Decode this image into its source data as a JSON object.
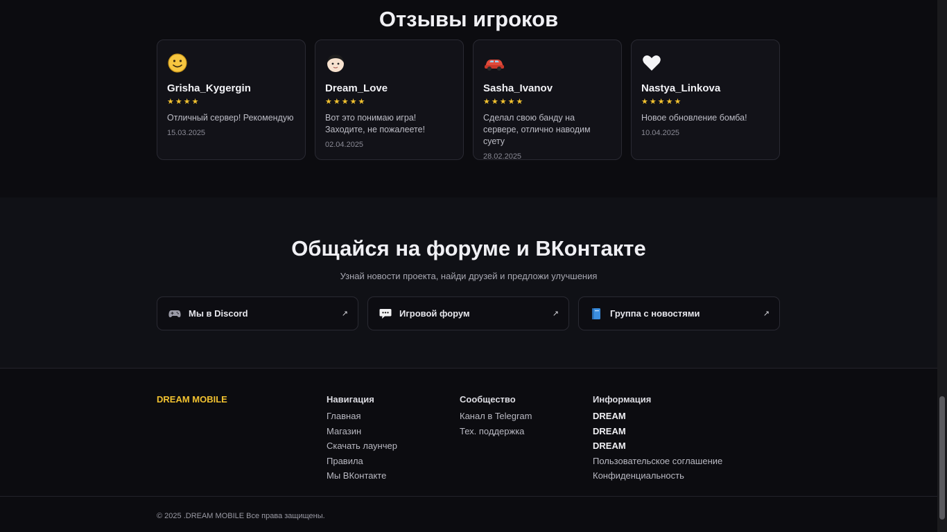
{
  "reviews": {
    "title": "Отзывы игроков",
    "items": [
      {
        "icon": "smiley-face-icon",
        "name": "Grisha_Kygergin",
        "stars": "★★★★",
        "text": "Отличный сервер! Рекомендую",
        "date": "15.03.2025"
      },
      {
        "icon": "person-face-icon",
        "name": "Dream_Love",
        "stars": "★★★★★",
        "text": "Вот это понимаю игра! Заходите, не пожалеете!",
        "date": "02.04.2025"
      },
      {
        "icon": "car-icon",
        "name": "Sasha_Ivanov",
        "stars": "★★★★★",
        "text": "Сделал свою банду на сервере, отлично наводим суету",
        "date": "28.02.2025"
      },
      {
        "icon": "white-heart-icon",
        "name": "Nastya_Linkova",
        "stars": "★★★★★",
        "text": "Новое обновление бомба!",
        "date": "10.04.2025"
      }
    ]
  },
  "community": {
    "title": "Общайся на форуме и ВКонтакте",
    "subtitle": "Узнай новости проекта, найди друзей и предложи улучшения",
    "links": [
      {
        "icon": "gamepad-icon",
        "label": "Мы в Discord",
        "arrow": "↗"
      },
      {
        "icon": "speech-bubble-icon",
        "label": "Игровой форум",
        "arrow": "↗"
      },
      {
        "icon": "book-icon",
        "label": "Группа с новостями",
        "arrow": "↗"
      }
    ]
  },
  "footer": {
    "brand": "DREAM MOBILE",
    "nav": {
      "title": "Навигация",
      "items": [
        "Главная",
        "Магазин",
        "Скачать лаунчер",
        "Правила",
        "Мы ВКонтакте"
      ]
    },
    "community": {
      "title": "Сообщество",
      "items": [
        "Канал в Telegram",
        "Тех. поддержка"
      ]
    },
    "info": {
      "title": "Информация",
      "items": [
        "DREAM",
        "DREAM",
        "DREAM",
        "Пользовательское соглашение",
        "Конфиденциальность"
      ]
    },
    "copyright": "© 2025 .DREAM MOBILE Все права защищены."
  },
  "colors": {
    "accent": "#f2c230",
    "background": "#0c0c10",
    "section_alt": "#101116"
  }
}
